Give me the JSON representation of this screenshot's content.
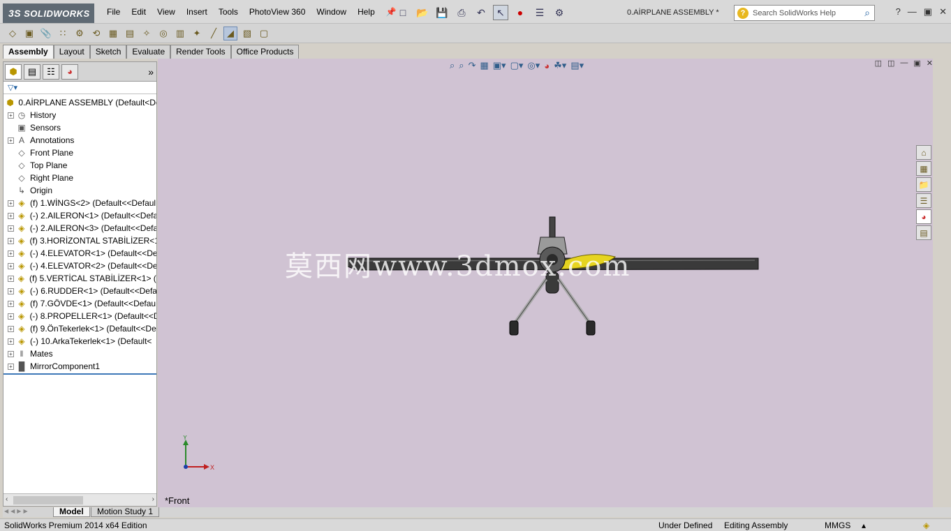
{
  "app": {
    "logo_text": "SOLIDWORKS",
    "logo_prefix": "3S",
    "document_title": "0.AİRPLANE ASSEMBLY *"
  },
  "menu": [
    "File",
    "Edit",
    "View",
    "Insert",
    "Tools",
    "PhotoView 360",
    "Window",
    "Help"
  ],
  "help_search": {
    "placeholder": "Search SolidWorks Help"
  },
  "command_tabs": [
    "Assembly",
    "Layout",
    "Sketch",
    "Evaluate",
    "Render Tools",
    "Office Products"
  ],
  "tree": {
    "root": "0.AİRPLANE ASSEMBLY  (Default<Def",
    "items": [
      {
        "label": "History",
        "icon": "history-icon",
        "expand": "+"
      },
      {
        "label": "Sensors",
        "icon": "sensors-icon",
        "expand": ""
      },
      {
        "label": "Annotations",
        "icon": "annotations-icon",
        "expand": "+"
      },
      {
        "label": "Front Plane",
        "icon": "plane-icon",
        "expand": ""
      },
      {
        "label": "Top Plane",
        "icon": "plane-icon",
        "expand": ""
      },
      {
        "label": "Right Plane",
        "icon": "plane-icon",
        "expand": ""
      },
      {
        "label": "Origin",
        "icon": "origin-icon",
        "expand": ""
      },
      {
        "label": "(f) 1.WİNGS<2> (Default<<Defaul",
        "icon": "part-icon",
        "expand": "+"
      },
      {
        "label": "(-) 2.AILERON<1> (Default<<Defa",
        "icon": "part-icon",
        "expand": "+"
      },
      {
        "label": "(-) 2.AILERON<3> (Default<<Defa",
        "icon": "part-icon",
        "expand": "+"
      },
      {
        "label": "(f) 3.HORİZONTAL STABİLİZER<1",
        "icon": "part-icon",
        "expand": "+"
      },
      {
        "label": "(-) 4.ELEVATOR<1> (Default<<De",
        "icon": "part-icon",
        "expand": "+"
      },
      {
        "label": "(-) 4.ELEVATOR<2> (Default<<De",
        "icon": "part-icon",
        "expand": "+"
      },
      {
        "label": "(f) 5.VERTİCAL STABİLİZER<1> (D",
        "icon": "part-icon",
        "expand": "+"
      },
      {
        "label": "(-) 6.RUDDER<1> (Default<<Defa",
        "icon": "part-icon",
        "expand": "+"
      },
      {
        "label": "(f) 7.GÖVDE<1> (Default<<Defau",
        "icon": "part-icon",
        "expand": "+"
      },
      {
        "label": "(-) 8.PROPELLER<1> (Default<<D",
        "icon": "part-icon",
        "expand": "+"
      },
      {
        "label": "(f) 9.ÖnTekerlek<1> (Default<<De",
        "icon": "part-icon",
        "expand": "+"
      },
      {
        "label": "(-) 10.ArkaTekerlek<1> (Default<",
        "icon": "part-icon",
        "expand": "+"
      },
      {
        "label": "Mates",
        "icon": "mates-icon",
        "expand": "+"
      },
      {
        "label": "MirrorComponent1",
        "icon": "mirror-component-icon",
        "expand": "+"
      }
    ]
  },
  "viewport": {
    "view_label": "*Front",
    "watermark": "莫西网www.3dmox.com",
    "triad_x": "X",
    "triad_y": "Y",
    "background": "#d0c3d3"
  },
  "bottom_tabs": [
    "Model",
    "Motion Study 1"
  ],
  "status": {
    "edition": "SolidWorks Premium 2014 x64 Edition",
    "definition": "Under Defined",
    "mode": "Editing Assembly",
    "units": "MMGS"
  }
}
